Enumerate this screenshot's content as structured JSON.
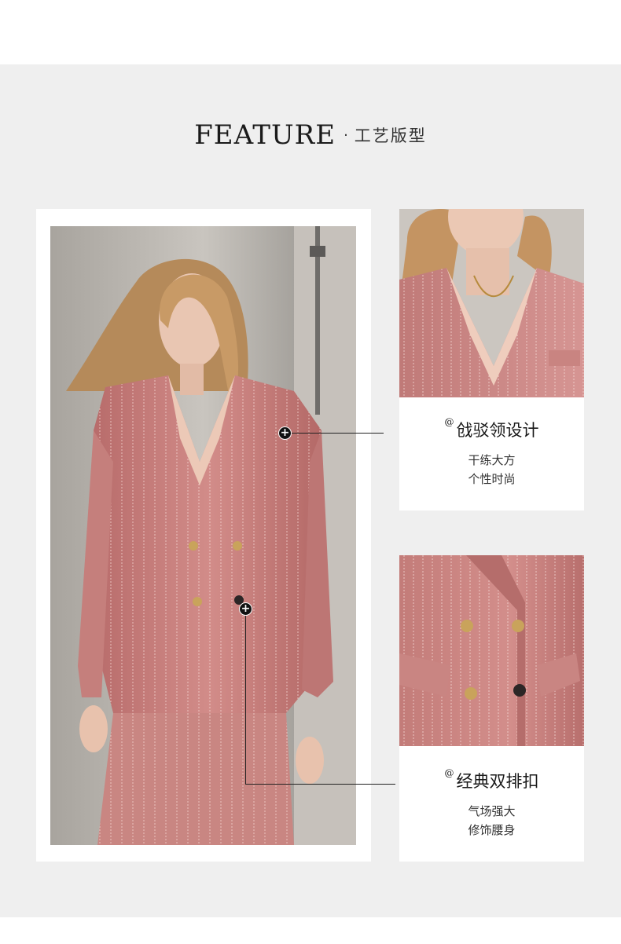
{
  "header": {
    "title_en": "FEATURE",
    "separator": "·",
    "title_cn": "工艺版型"
  },
  "features": [
    {
      "at": "@",
      "title": "戗驳领设计",
      "desc_line1": "干练大方",
      "desc_line2": "个性时尚"
    },
    {
      "at": "@",
      "title": "经典双排扣",
      "desc_line1": "气场强大",
      "desc_line2": "修饰腰身"
    }
  ],
  "markers": {
    "symbol": "+"
  },
  "colors": {
    "background": "#efefef",
    "suit": "#c97d7b",
    "accent": "#111111"
  }
}
